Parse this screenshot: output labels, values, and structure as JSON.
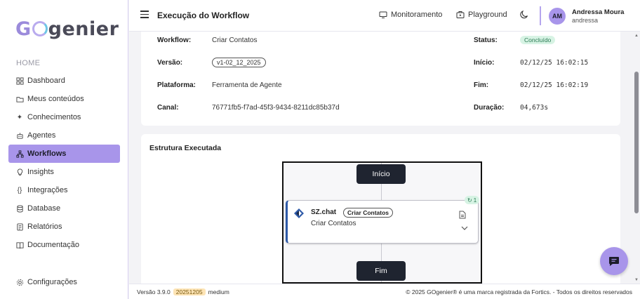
{
  "brand": {
    "logo_g": "G",
    "logo_rest": "genier"
  },
  "sidebar": {
    "section": "HOME",
    "items": [
      {
        "label": "Dashboard",
        "icon": "grid-icon"
      },
      {
        "label": "Meus conteúdos",
        "icon": "folder-icon"
      },
      {
        "label": "Conhecimentos",
        "icon": "sparkle-icon"
      },
      {
        "label": "Agentes",
        "icon": "robot-icon"
      },
      {
        "label": "Workflows",
        "icon": "workflow-icon",
        "active": true
      },
      {
        "label": "Insights",
        "icon": "lightbulb-icon"
      },
      {
        "label": "Integrações",
        "icon": "braces-icon"
      },
      {
        "label": "Database",
        "icon": "database-icon"
      },
      {
        "label": "Relatórios",
        "icon": "report-icon"
      },
      {
        "label": "Documentação",
        "icon": "book-icon"
      }
    ],
    "bottom": {
      "label": "Configurações",
      "icon": "gear-icon"
    }
  },
  "header": {
    "title": "Execução do Workflow",
    "monitor_label": "Monitoramento",
    "playground_label": "Playground",
    "user": {
      "initials": "AM",
      "name": "Andressa Moura",
      "login": "andressa"
    }
  },
  "details": {
    "workflow_label": "Workflow:",
    "workflow_value": "Criar Contatos",
    "version_label": "Versão:",
    "version_value": "v1-02_12_2025",
    "platform_label": "Plataforma:",
    "platform_value": "Ferramenta de Agente",
    "channel_label": "Canal:",
    "channel_value": "76771fb5-f7ad-45f3-9434-8211dc85b37d",
    "status_label": "Status:",
    "status_value": "Concluído",
    "start_label": "Início:",
    "start_value": "02/12/25 16:02:15",
    "end_label": "Fim:",
    "end_value": "02/12/25 16:02:19",
    "duration_label": "Duração:",
    "duration_value": "04,673s"
  },
  "structure": {
    "title": "Estrutura Executada",
    "start_node": "Início",
    "end_node": "Fim",
    "task": {
      "name": "SZ.chat",
      "tag": "Criar Contatos",
      "subtitle": "Criar Contatos",
      "retry_count": "1"
    }
  },
  "footer": {
    "version_prefix": "Versão 3.9.0",
    "build": "20251205",
    "tier": "medium",
    "copyright": "© 2025 GOgenier® é uma marca registrada da Fortics. - Todos os direitos reservados"
  },
  "colors": {
    "accent": "#a895ea",
    "success_bg": "#d7f3e4",
    "dark_node": "#1f2430"
  }
}
